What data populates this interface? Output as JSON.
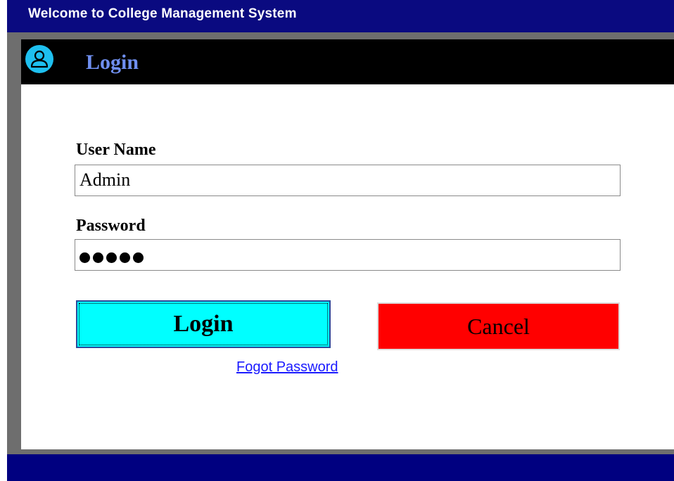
{
  "window": {
    "title": "Welcome to College Management System"
  },
  "header": {
    "icon": "user-icon",
    "title": "Login"
  },
  "form": {
    "username_label": "User Name",
    "username_value": "Admin",
    "password_label": "Password",
    "password_length": 5
  },
  "buttons": {
    "login_label": "Login",
    "cancel_label": "Cancel"
  },
  "links": {
    "forgot_password": "Fogot Password"
  },
  "colors": {
    "title_bar": "#0a0a80",
    "header_bar": "#000000",
    "header_title": "#6f8ff0",
    "login_button": "#00ffff",
    "cancel_button": "#ff0000",
    "link": "#1a1aff",
    "status_bar": "#000080"
  }
}
